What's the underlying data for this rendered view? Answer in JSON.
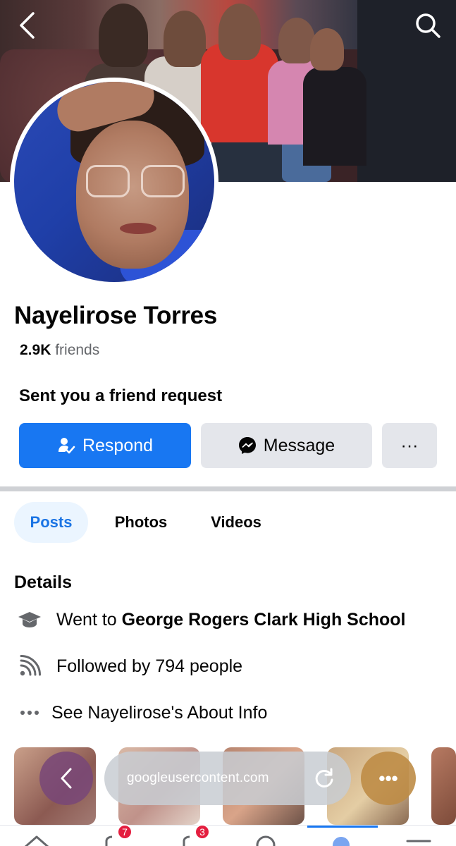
{
  "profile": {
    "name": "Nayelirose Torres",
    "friends_count": "2.9K",
    "friends_label": "friends",
    "request_text": "Sent you a friend request"
  },
  "actions": {
    "respond_label": "Respond",
    "message_label": "Message",
    "more_label": "···"
  },
  "tabs": [
    {
      "label": "Posts",
      "active": true
    },
    {
      "label": "Photos",
      "active": false
    },
    {
      "label": "Videos",
      "active": false
    }
  ],
  "details": {
    "title": "Details",
    "school_prefix": "Went to ",
    "school_name": "George Rogers Clark High School",
    "followers": "Followed by 794 people",
    "about": "See Nayelirose's About Info"
  },
  "browser": {
    "url": "googleusercontent.com",
    "more_label": "•••"
  },
  "bottom_nav": {
    "badges": [
      "7",
      "3"
    ]
  },
  "colors": {
    "accent": "#1877f2",
    "tab_active_bg": "#ebf5ff",
    "badge": "#e41e3f"
  },
  "icons": [
    "chevron-left-icon",
    "search-icon",
    "add-friend-icon",
    "messenger-icon",
    "graduation-cap-icon",
    "rss-icon",
    "more-dots-icon",
    "reload-icon"
  ]
}
